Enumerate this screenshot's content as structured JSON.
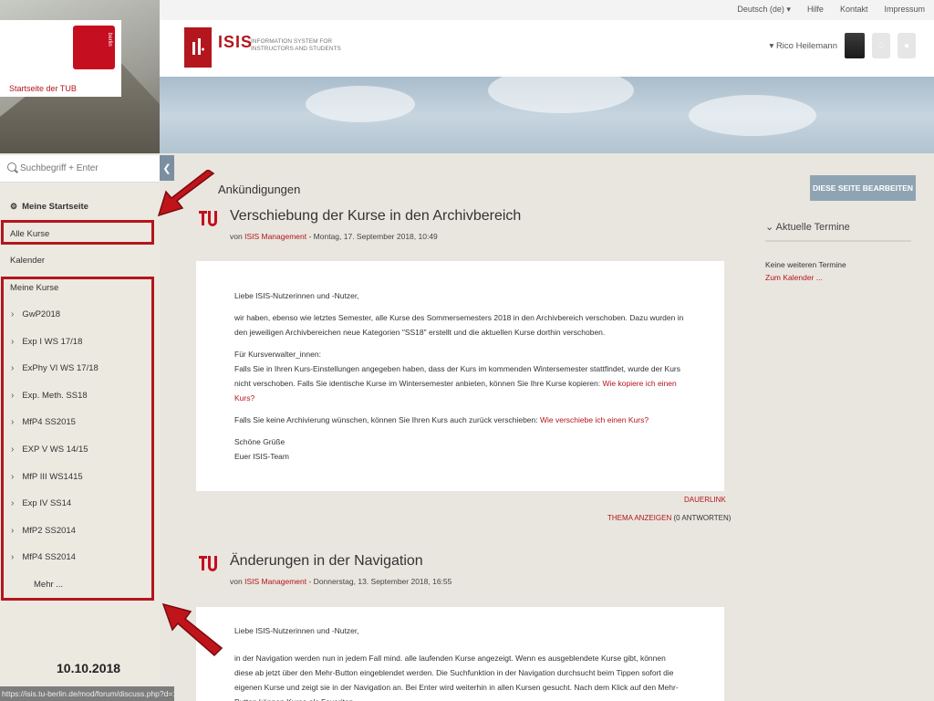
{
  "top_links": [
    "Deutsch (de) ▾",
    "Hilfe",
    "Kontakt",
    "Impressum"
  ],
  "brand": {
    "tu_link": "Startseite der TUB",
    "tu_text": "berlin",
    "isis_name": "ISIS",
    "isis_sub": "INFORMATION SYSTEM FOR INSTRUCTORS AND STUDENTS"
  },
  "user": {
    "name": "▾ Rico Heilemann"
  },
  "search": {
    "placeholder": "Suchbegriff + Enter"
  },
  "nav": {
    "home": "Meine Startseite",
    "all_courses": "Alle Kurse",
    "calendar": "Kalender",
    "my_courses": "Meine Kurse",
    "courses": [
      "GwP2018",
      "Exp I WS 17/18",
      "ExPhy VI WS 17/18",
      "Exp. Meth. SS18",
      "MfP4 SS2015",
      "EXP V WS 14/15",
      "MfP III WS1415",
      "Exp IV SS14",
      "MfP2 SS2014",
      "MfP4 SS2014"
    ],
    "more": "Mehr ..."
  },
  "date_label": "10.10.2018",
  "status_url": "https://isis.tu-berlin.de/mod/forum/discuss.php?d=197759#p374222",
  "main": {
    "edit_button": "DIESE SEITE BEARBEITEN",
    "section_title": "Ankündigungen",
    "post1": {
      "title": "Verschiebung der Kurse in den Archivbereich",
      "meta_prefix": "von ",
      "author": "ISIS Management",
      "meta_date": " - Montag, 17. September 2018, 10:49",
      "greeting": "Liebe ISIS-Nutzerinnen und -Nutzer,",
      "p1": "wir haben, ebenso wie letztes Semester, alle Kurse des Sommersemesters 2018 in den Archivbereich verschoben. Dazu wurden in den jeweiligen Archivbereichen neue Kategorien \"SS18\" erstellt und die aktuellen Kurse dorthin verschoben.",
      "p2a": "Für Kursverwalter_innen:",
      "p2b": "Falls Sie in Ihren Kurs-Einstellungen angegeben haben, dass der Kurs im kommenden Wintersemester stattfindet, wurde der Kurs nicht verschoben. Falls Sie identische Kurse im Wintersemester anbieten, können Sie Ihre Kurse kopieren: ",
      "p2link": "Wie kopiere ich einen Kurs?",
      "p3": "Falls Sie keine Archivierung wünschen, können Sie Ihren Kurs auch zurück verschieben: ",
      "p3link": "Wie verschiebe ich einen Kurs?",
      "closing1": "Schöne Grüße",
      "closing2": "Euer ISIS-Team",
      "permalink": "DAUERLINK",
      "show_topic": "THEMA ANZEIGEN",
      "replies": " (0 ANTWORTEN)"
    },
    "post2": {
      "title": "Änderungen in der Navigation",
      "meta_prefix": "von ",
      "author": "ISIS Management",
      "meta_date": " - Donnerstag, 13. September 2018, 16:55",
      "greeting": "Liebe ISIS-Nutzerinnen und -Nutzer,",
      "p1": "in der Navigation werden nun in jedem Fall mind. alle laufenden Kurse angezeigt. Wenn es ausgeblendete Kurse gibt, können diese ab jetzt über den Mehr-Button eingeblendet werden. Die Suchfunktion in der Navigation durchsucht beim Tippen sofort die eigenen Kurse und zeigt sie in der Navigation an. Bei Enter wird weiterhin in allen Kursen gesucht. Nach dem Klick auf den Mehr-Button können Kurse als Favoriten"
    }
  },
  "termine": {
    "title": "Aktuelle Termine",
    "none": "Keine weiteren Termine",
    "calendar_link": "Zum Kalender ..."
  },
  "colors": {
    "accent": "#b3161c",
    "arrow": "#c0141b"
  }
}
